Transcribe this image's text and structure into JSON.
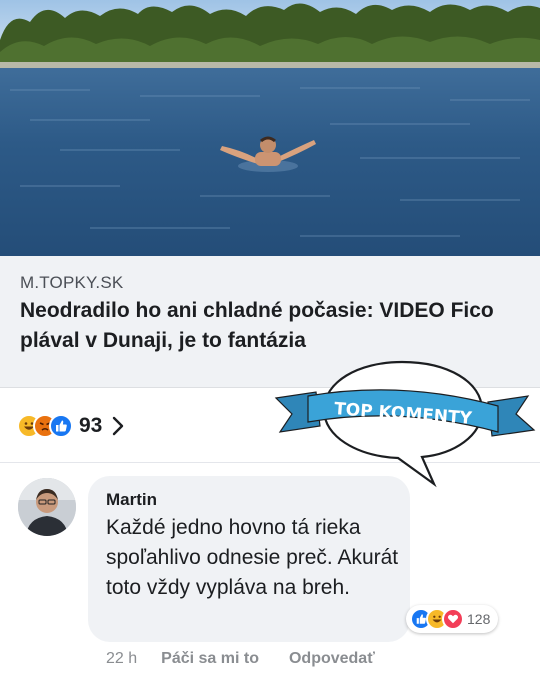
{
  "post": {
    "image_alt": "Man swimming in the river",
    "link_domain": "M.TOPKY.SK",
    "link_title": "Neodradilo ho ani chladné počasie: VIDEO Fico plával v Dunaji, je to fantázia",
    "reactions": {
      "icons": [
        "haha-icon",
        "angry-icon",
        "like-icon"
      ],
      "count": "93"
    }
  },
  "sticker": {
    "label": "TOP KOMENTY"
  },
  "comment": {
    "author": "Martin",
    "text": "Každé jedno hovno tá rieka spoľahlivo odnesie preč. Akurát toto vždy vypláva na breh.",
    "reactions": {
      "icons": [
        "like-icon",
        "haha-icon",
        "love-icon"
      ],
      "count": "128"
    },
    "time": "22 h",
    "like_label": "Páči sa mi to",
    "reply_label": "Odpovedať"
  },
  "colors": {
    "like_blue": "#1877f2",
    "haha_yellow": "#f7b928",
    "angry_red": "#e9710f",
    "love_red": "#f33e58",
    "ribbon_blue": "#3aa3d8"
  }
}
